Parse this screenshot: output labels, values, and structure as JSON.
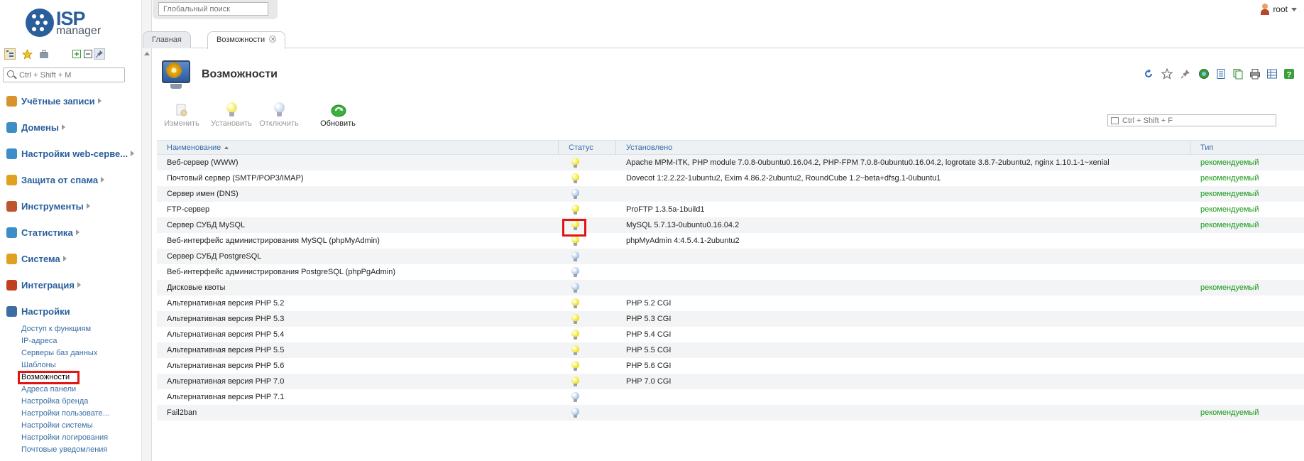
{
  "brand": {
    "logo_main": "ISP",
    "logo_sub": "manager"
  },
  "global_search": {
    "placeholder": "Глобальный поиск"
  },
  "user": {
    "name": "root"
  },
  "sidebar": {
    "search_placeholder": "Ctrl + Shift + M",
    "menu": [
      {
        "label": "Учётные записи",
        "icon": "user-icon",
        "color": "#d8922e"
      },
      {
        "label": "Домены",
        "icon": "globe-icon",
        "color": "#3c8dc8"
      },
      {
        "label": "Настройки web-серве...",
        "icon": "web-settings-icon",
        "color": "#3c8dc8"
      },
      {
        "label": "Защита от спама",
        "icon": "spam-shield-icon",
        "color": "#e0a020"
      },
      {
        "label": "Инструменты",
        "icon": "tools-icon",
        "color": "#c0542a"
      },
      {
        "label": "Статистика",
        "icon": "statistics-icon",
        "color": "#3c8dc8"
      },
      {
        "label": "Система",
        "icon": "system-icon",
        "color": "#e0a020"
      },
      {
        "label": "Интеграция",
        "icon": "integration-icon",
        "color": "#c04020"
      },
      {
        "label": "Настройки",
        "icon": "settings-icon",
        "color": "#3c6ea5"
      }
    ],
    "settings_sub": [
      "Доступ к функциям",
      "IP-адреса",
      "Серверы баз данных",
      "Шаблоны",
      "Возможности",
      "Адреса панели",
      "Настройка бренда",
      "Настройки пользовате...",
      "Настройки системы",
      "Настройки логирования",
      "Почтовые уведомления"
    ],
    "active_sub": "Возможности"
  },
  "tabs": [
    {
      "label": "Главная"
    },
    {
      "label": "Возможности"
    }
  ],
  "page": {
    "title": "Возможности"
  },
  "toolbar": {
    "edit": "Изменить",
    "install": "Установить",
    "disable": "Отключить",
    "refresh": "Обновить"
  },
  "table_filter": {
    "placeholder": "Ctrl + Shift + F"
  },
  "table": {
    "columns": {
      "name": "Наименование",
      "status": "Статус",
      "installed": "Установлено",
      "type": "Тип"
    },
    "rows": [
      {
        "name": "Веб-сервер (WWW)",
        "status": "on",
        "installed": "Apache MPM-ITK, PHP module 7.0.8-0ubuntu0.16.04.2, PHP-FPM 7.0.8-0ubuntu0.16.04.2, logrotate 3.8.7-2ubuntu2, nginx 1.10.1-1~xenial",
        "type": "рекомендуемый"
      },
      {
        "name": "Почтовый сервер (SMTP/POP3/IMAP)",
        "status": "on",
        "installed": "Dovecot 1:2.2.22-1ubuntu2, Exim 4.86.2-2ubuntu2, RoundCube 1.2~beta+dfsg.1-0ubuntu1",
        "type": "рекомендуемый"
      },
      {
        "name": "Сервер имен (DNS)",
        "status": "off",
        "installed": "",
        "type": "рекомендуемый"
      },
      {
        "name": "FTP-сервер",
        "status": "on",
        "installed": "ProFTP 1.3.5a-1build1",
        "type": "рекомендуемый"
      },
      {
        "name": "Сервер СУБД MySQL",
        "status": "on",
        "installed": "MySQL 5.7.13-0ubuntu0.16.04.2",
        "type": "рекомендуемый"
      },
      {
        "name": "Веб-интерфейс администрирования MySQL (phpMyAdmin)",
        "status": "on",
        "installed": "phpMyAdmin 4:4.5.4.1-2ubuntu2",
        "type": ""
      },
      {
        "name": "Сервер СУБД PostgreSQL",
        "status": "off",
        "installed": "",
        "type": ""
      },
      {
        "name": "Веб-интерфейс администрирования PostgreSQL (phpPgAdmin)",
        "status": "off",
        "installed": "",
        "type": ""
      },
      {
        "name": "Дисковые квоты",
        "status": "off",
        "installed": "",
        "type": "рекомендуемый"
      },
      {
        "name": "Альтернативная версия PHP 5.2",
        "status": "on",
        "installed": "PHP 5.2 CGI",
        "type": ""
      },
      {
        "name": "Альтернативная версия PHP 5.3",
        "status": "on",
        "installed": "PHP 5.3 CGI",
        "type": ""
      },
      {
        "name": "Альтернативная версия PHP 5.4",
        "status": "on",
        "installed": "PHP 5.4 CGI",
        "type": ""
      },
      {
        "name": "Альтернативная версия PHP 5.5",
        "status": "on",
        "installed": "PHP 5.5 CGI",
        "type": ""
      },
      {
        "name": "Альтернативная версия PHP 5.6",
        "status": "on",
        "installed": "PHP 5.6 CGI",
        "type": ""
      },
      {
        "name": "Альтернативная версия PHP 7.0",
        "status": "on",
        "installed": "PHP 7.0 CGI",
        "type": ""
      },
      {
        "name": "Альтернативная версия PHP 7.1",
        "status": "off",
        "installed": "",
        "type": ""
      },
      {
        "name": "Fail2ban",
        "status": "off",
        "installed": "",
        "type": "рекомендуемый"
      }
    ]
  },
  "colors": {
    "accent": "#2a5f9c",
    "link": "#3a6ea5",
    "recommended": "#1a9a1a",
    "highlight": "#e01515"
  }
}
